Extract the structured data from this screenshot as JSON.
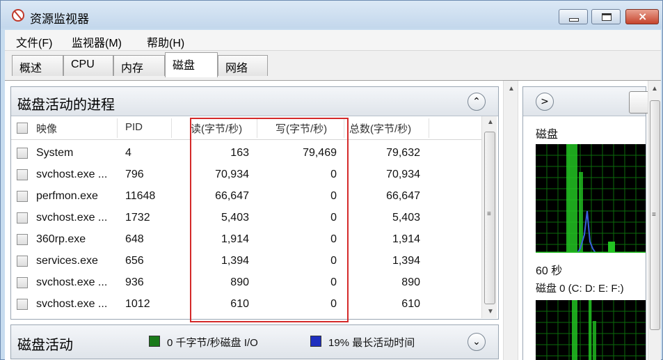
{
  "window": {
    "title": "资源监视器",
    "close_glyph": "×"
  },
  "menu": [
    "文件(F)",
    "监视器(M)",
    "帮助(H)"
  ],
  "tabs": [
    "概述",
    "CPU",
    "内存",
    "磁盘",
    "网络"
  ],
  "active_tab": "磁盘",
  "process_panel": {
    "title": "磁盘活动的进程",
    "collapse_glyph": "⌃",
    "columns": [
      "映像",
      "PID",
      "读(字节/秒)",
      "写(字节/秒)",
      "总数(字节/秒)"
    ],
    "rows": [
      {
        "image": "System",
        "pid": "4",
        "read": "163",
        "write": "79,469",
        "total": "79,632"
      },
      {
        "image": "svchost.exe ...",
        "pid": "796",
        "read": "70,934",
        "write": "0",
        "total": "70,934"
      },
      {
        "image": "perfmon.exe",
        "pid": "11648",
        "read": "66,647",
        "write": "0",
        "total": "66,647"
      },
      {
        "image": "svchost.exe ...",
        "pid": "1732",
        "read": "5,403",
        "write": "0",
        "total": "5,403"
      },
      {
        "image": "360rp.exe",
        "pid": "648",
        "read": "1,914",
        "write": "0",
        "total": "1,914"
      },
      {
        "image": "services.exe",
        "pid": "656",
        "read": "1,394",
        "write": "0",
        "total": "1,394"
      },
      {
        "image": "svchost.exe ...",
        "pid": "936",
        "read": "890",
        "write": "0",
        "total": "890"
      },
      {
        "image": "svchost.exe ...",
        "pid": "1012",
        "read": "610",
        "write": "0",
        "total": "610"
      }
    ]
  },
  "disk_activity_panel": {
    "title": "磁盘活动",
    "io_legend": "0 千字节/秒磁盘 I/O",
    "active_legend": "19% 最长活动时间",
    "io_color": "#1a7a1a",
    "active_color": "#1f2fbf",
    "expand_glyph": "⌄"
  },
  "right_panel": {
    "nav_glyph": ">",
    "graph1_label": "磁盘",
    "time_label": "60 秒",
    "graph2_label": "磁盘 0 (C: D: E: F:)"
  },
  "scroll_glyphs": {
    "up": "▲",
    "down": "▼",
    "grip": "≡"
  },
  "colors": {
    "highlight": "#d42a2a",
    "graph_green": "#22c322",
    "graph_blue": "#3a5fe0"
  }
}
